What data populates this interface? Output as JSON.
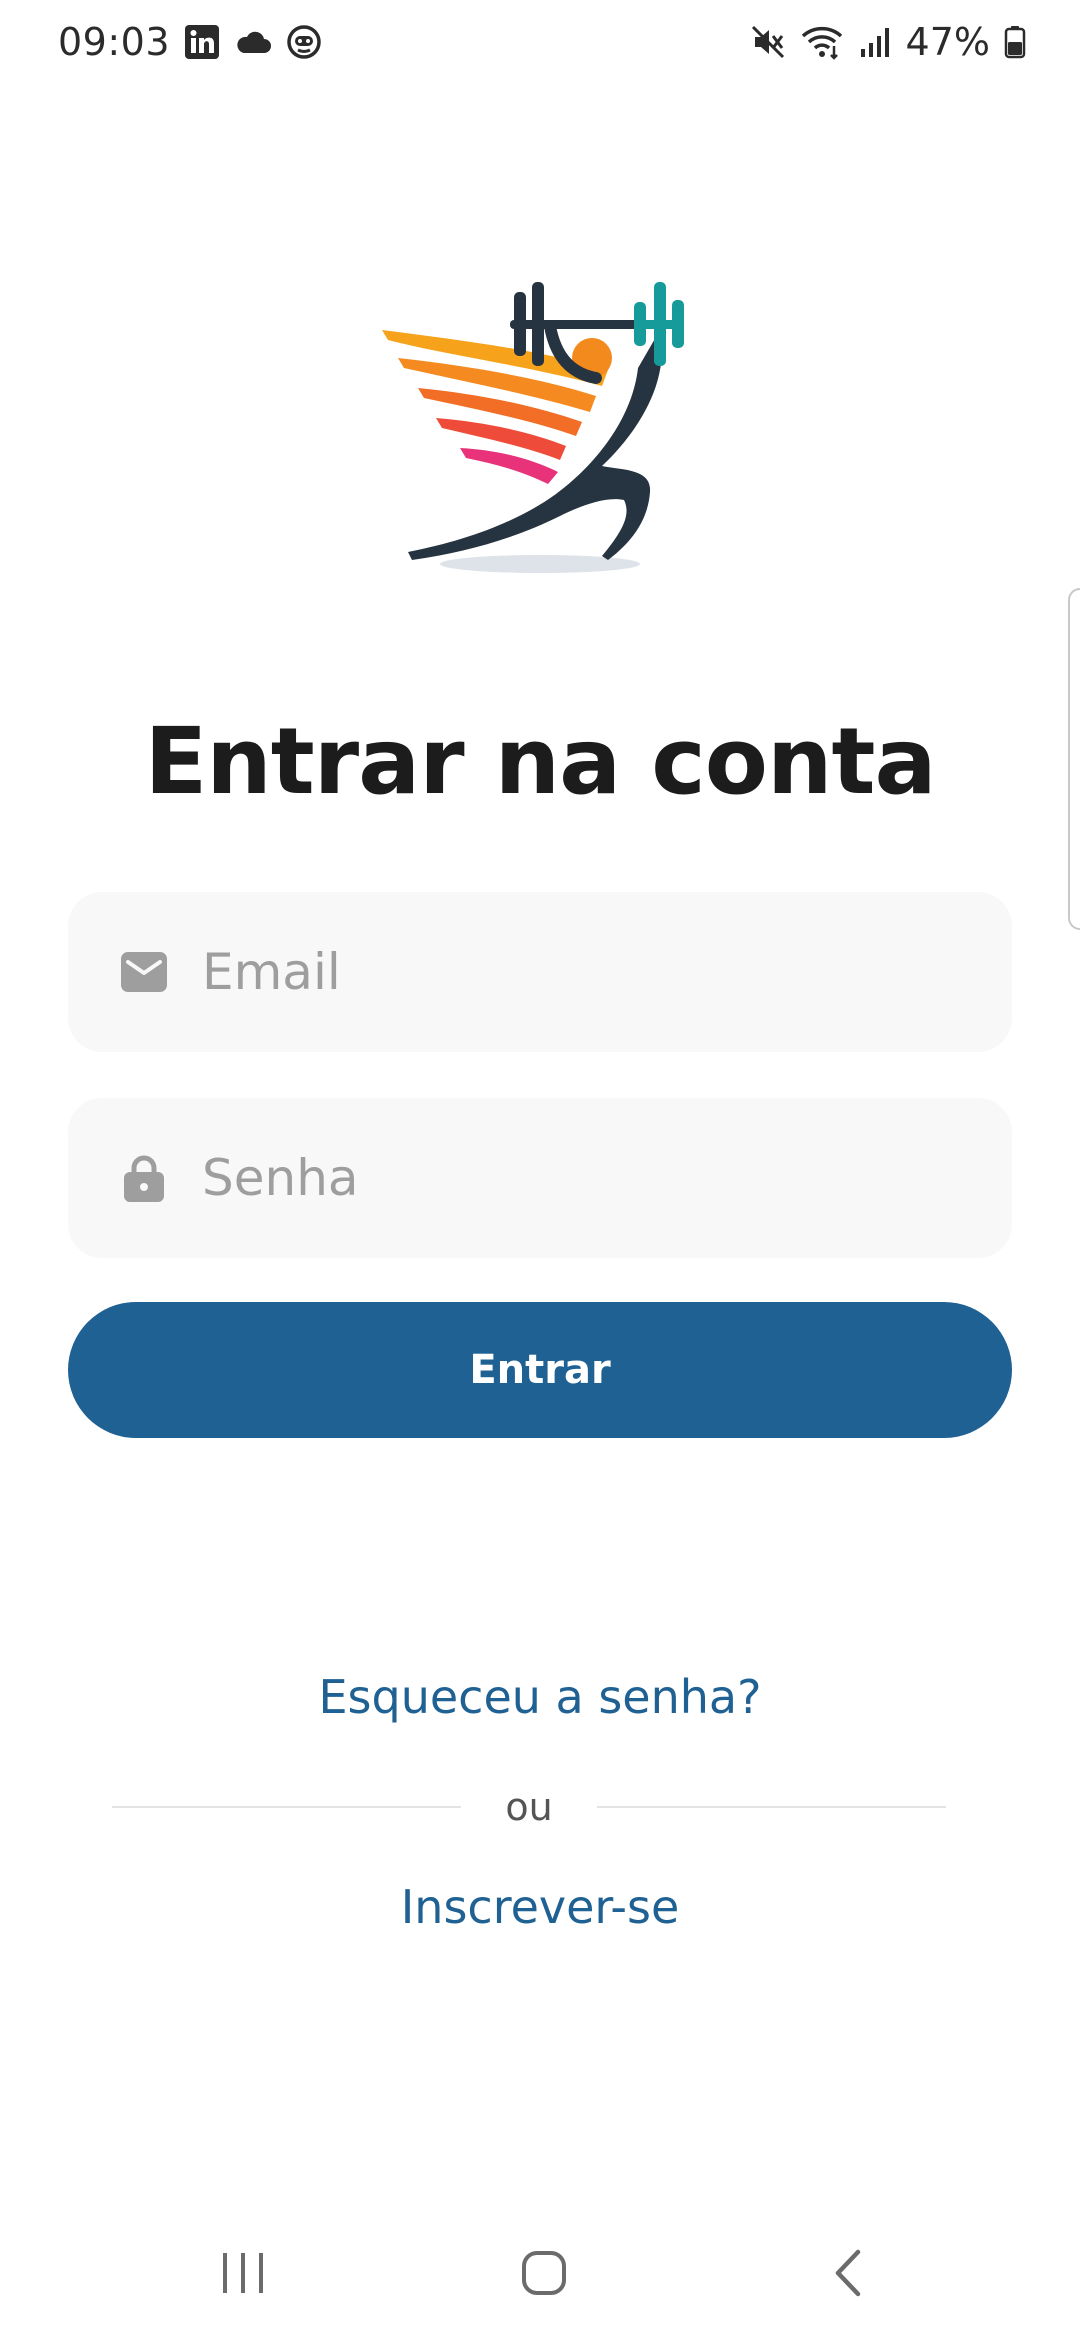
{
  "status_bar": {
    "time": "09:03",
    "battery": "47%",
    "icons_left": [
      "linkedin-icon",
      "cloud-icon",
      "robot-face-icon"
    ],
    "icons_right": [
      "mute-icon",
      "wifi-icon",
      "signal-icon",
      "battery-icon"
    ]
  },
  "logo": {
    "name": "fitness-athlete-logo",
    "colors": {
      "dark": "#263340",
      "teal": "#179a9a",
      "orange": "#f28a1e",
      "red": "#ef3e4a",
      "pink": "#e8337b"
    }
  },
  "login": {
    "title": "Entrar na conta",
    "email_placeholder": "Email",
    "password_placeholder": "Senha",
    "submit_label": "Entrar",
    "forgot_label": "Esqueceu a senha?",
    "divider_text": "ou",
    "signup_label": "Inscrever-se"
  },
  "theme": {
    "primary": "#206194",
    "field_bg": "#f8f8f8",
    "placeholder": "#9e9e9e"
  },
  "nav_bar": {
    "items": [
      "recents-icon",
      "home-icon",
      "back-icon"
    ]
  }
}
